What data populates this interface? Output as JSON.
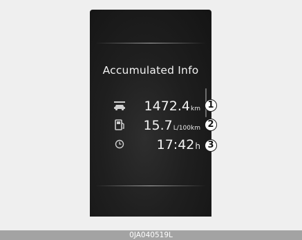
{
  "cluster": {
    "title": "Accumulated Info",
    "rows": [
      {
        "icon": "car-distance-icon",
        "value": "1472.4",
        "unit": "km",
        "callout": "1"
      },
      {
        "icon": "fuel-pump-icon",
        "value": "15.7",
        "unit": "L/100km",
        "callout": "2"
      },
      {
        "icon": "clock-icon",
        "value": "17:42",
        "unit": "h",
        "callout": "3"
      }
    ]
  },
  "footer": {
    "code": "0JA040519L"
  }
}
